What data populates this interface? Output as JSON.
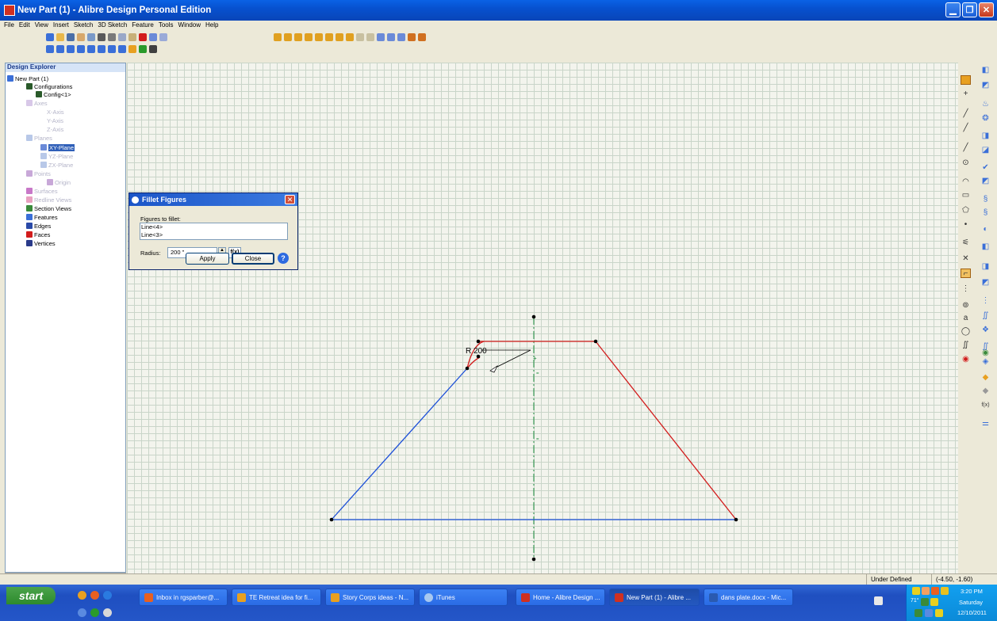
{
  "window": {
    "title": "New Part (1) - Alibre Design Personal Edition"
  },
  "menu": [
    "File",
    "Edit",
    "View",
    "Insert",
    "Sketch",
    "3D Sketch",
    "Feature",
    "Tools",
    "Window",
    "Help"
  ],
  "explorer": {
    "title": "Design Explorer",
    "items": [
      "New Part (1)",
      "Configurations",
      "Config<1>",
      "Axes",
      "X-Axis",
      "Y-Axis",
      "Z-Axis",
      "Planes",
      "XY-Plane",
      "YZ-Plane",
      "ZX-Plane",
      "Points",
      "Origin",
      "Surfaces",
      "Redline Views",
      "Section Views",
      "Features",
      "Edges",
      "Faces",
      "Vertices"
    ]
  },
  "dialog": {
    "title": "Fillet Figures",
    "figures_label": "Figures to fillet:",
    "figures": [
      "Line<4>",
      "Line<3>"
    ],
    "radius_label": "Radius:",
    "radius_value": "200 \"",
    "fx_label": "f(x)",
    "apply": "Apply",
    "close": "Close",
    "help": "?"
  },
  "sketch": {
    "dimension_label": "R 200"
  },
  "right_toolbar": {
    "fx_label": "f(x)",
    "text_tool": "a"
  },
  "status": {
    "state": "Under Defined",
    "coords": "(-4.50, -1.60)"
  },
  "taskbar": {
    "start": "start",
    "buttons": [
      "Inbox in rgsparber@...",
      "TE Retreat idea for fi...",
      "Story Corps ideas - N...",
      "iTunes",
      "Home - Alibre Design ...",
      "New Part (1) - Alibre ...",
      "dans plate.docx - Mic..."
    ],
    "clock": {
      "time": "3:20 PM",
      "day": "Saturday",
      "date": "12/10/2011"
    },
    "temp": "71°"
  },
  "colors": {
    "accent_blue": "#0a62e5",
    "sketch_red": "#d21c1c",
    "sketch_blue": "#1c4fd8",
    "centerline_green": "#1a8a3a"
  }
}
